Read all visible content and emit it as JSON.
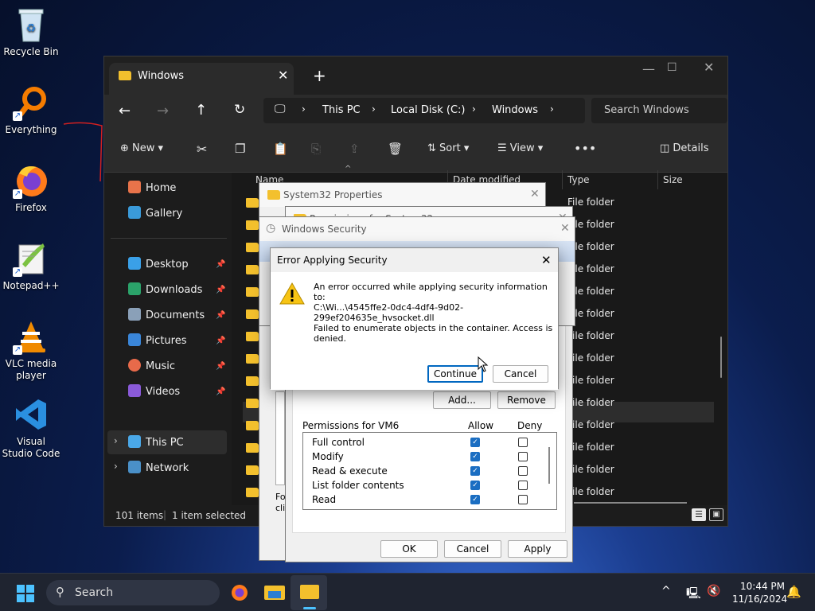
{
  "desktop": {
    "icons": [
      {
        "label": "Recycle Bin",
        "icon": "recycle-bin-icon"
      },
      {
        "label": "Everything",
        "icon": "everything-search-icon"
      },
      {
        "label": "Firefox",
        "icon": "firefox-icon"
      },
      {
        "label": "Notepad++",
        "icon": "notepad-plus-plus-icon"
      },
      {
        "label": "VLC media player",
        "icon": "vlc-icon"
      },
      {
        "label": "Visual Studio Code",
        "icon": "vscode-icon"
      }
    ]
  },
  "explorer": {
    "tab_title": "Windows",
    "breadcrumb": [
      "This PC",
      "Local Disk (C:)",
      "Windows"
    ],
    "search_placeholder": "Search Windows",
    "toolbar": {
      "new": "New",
      "sort": "Sort",
      "view": "View",
      "details": "Details"
    },
    "nav": {
      "home": "Home",
      "gallery": "Gallery",
      "desktop": "Desktop",
      "downloads": "Downloads",
      "documents": "Documents",
      "pictures": "Pictures",
      "music": "Music",
      "videos": "Videos",
      "this_pc": "This PC",
      "network": "Network"
    },
    "columns": {
      "name": "Name",
      "date": "Date modified",
      "type": "Type",
      "size": "Size"
    },
    "file_type": "File folder",
    "status": {
      "count": "101 items",
      "selected": "1 item selected"
    }
  },
  "properties_dialog": {
    "title": "System32 Properties",
    "partial_text_1": "Fo",
    "partial_text_2": "clic",
    "buttons": {
      "ok": "OK",
      "cancel": "Cancel",
      "apply": "Apply"
    }
  },
  "permissions_dialog": {
    "title": "Permissions for System32",
    "add": "Add...",
    "remove": "Remove",
    "permissions_for": "Permissions for VM6",
    "allow": "Allow",
    "deny": "Deny",
    "rows": [
      {
        "name": "Full control",
        "allow": true,
        "deny": false
      },
      {
        "name": "Modify",
        "allow": true,
        "deny": false
      },
      {
        "name": "Read & execute",
        "allow": true,
        "deny": false
      },
      {
        "name": "List folder contents",
        "allow": true,
        "deny": false
      },
      {
        "name": "Read",
        "allow": true,
        "deny": false
      }
    ]
  },
  "security_dialog": {
    "title": "Windows Security"
  },
  "error_dialog": {
    "title": "Error Applying Security",
    "line1": "An error occurred while applying security information to:",
    "path": "C:\\Wi...\\4545ffe2-0dc4-4df4-9d02-299ef204635e_hvsocket.dll",
    "line3": "Failed to enumerate objects in the container. Access is denied.",
    "continue": "Continue",
    "cancel": "Cancel"
  },
  "taskbar": {
    "search": "Search",
    "time": "10:44 PM",
    "date": "11/16/2024"
  }
}
